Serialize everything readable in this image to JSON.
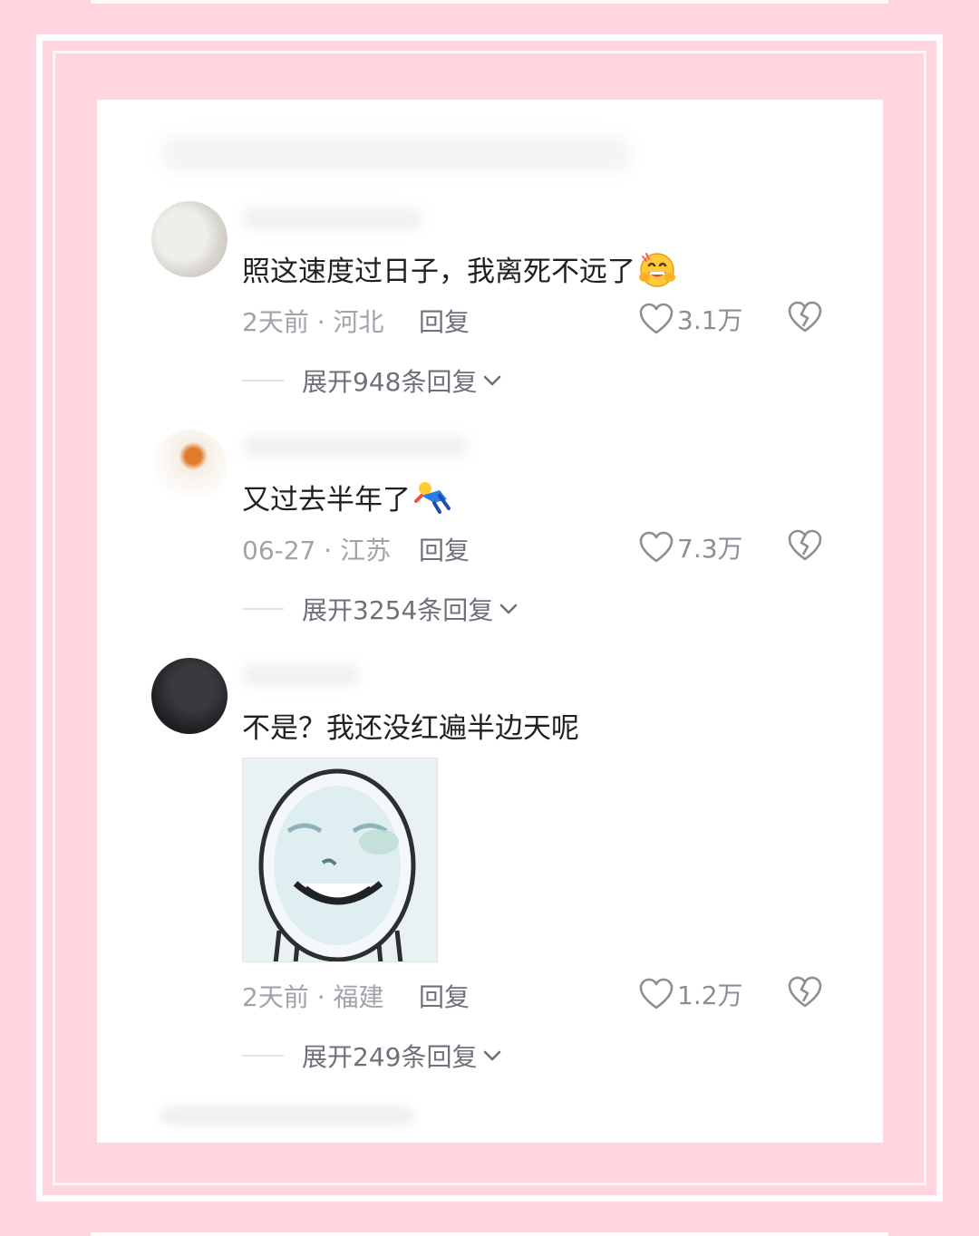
{
  "comments": [
    {
      "text": "照这速度过日子，我离死不远了",
      "emoji": "hugging-laughing-emoji",
      "meta": "2天前 · 河北",
      "reply_label": "回复",
      "likes": "3.1万",
      "expand_label": "展开948条回复"
    },
    {
      "text": "又过去半年了",
      "emoji": "falling-person-emoji",
      "meta": "06-27 · 江苏",
      "reply_label": "回复",
      "likes": "7.3万",
      "expand_label": "展开3254条回复"
    },
    {
      "text": "不是？我还没红遍半边天呢",
      "sticker": "smiling-face-meme-sticker",
      "meta": "2天前 · 福建",
      "reply_label": "回复",
      "likes": "1.2万",
      "expand_label": "展开249条回复"
    }
  ],
  "icons": {
    "like": "heart-outline-icon",
    "dislike": "broken-heart-icon",
    "expand": "chevron-down-icon"
  },
  "colors": {
    "frame": "#ffd5df",
    "card": "#ffffff",
    "text": "#1f1f24",
    "meta": "#a2a2aa"
  }
}
